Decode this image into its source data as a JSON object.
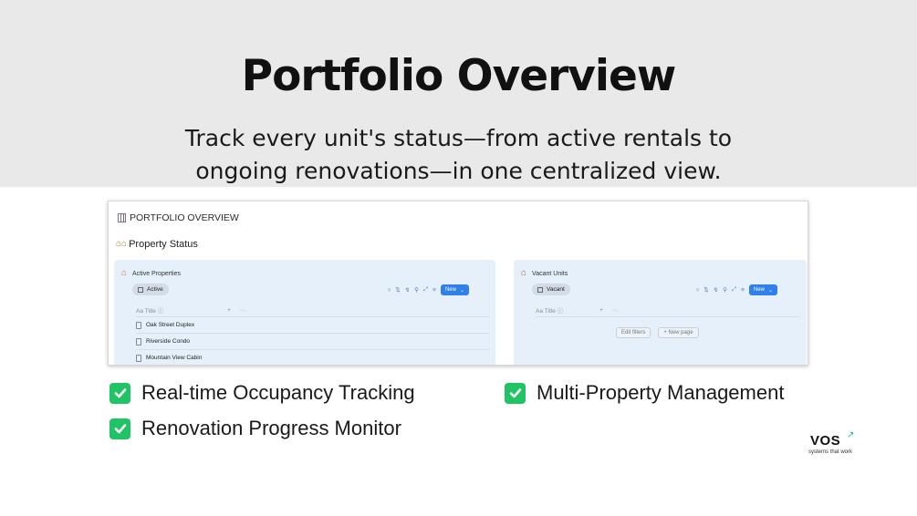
{
  "hero": {
    "title": "Portfolio Overview",
    "subtitle": "Track every unit's status—from active rentals to ongoing renovations—in one centralized view."
  },
  "screenshot": {
    "page_title": "PORTFOLIO OVERVIEW",
    "section_title": "Property Status",
    "left_panel": {
      "heading": "Active Properties",
      "view_label": "Active",
      "new_label": "New",
      "column_title": "Title",
      "rows": [
        "Oak Street Duplex",
        "Riverside Condo",
        "Mountain View Cabin"
      ]
    },
    "right_panel": {
      "heading": "Vacant Units",
      "view_label": "Vacant",
      "new_label": "New",
      "column_title": "Title",
      "edit_filters": "Edit filters",
      "new_page": "+ New page"
    }
  },
  "features": [
    "Real-time Occupancy Tracking",
    "Multi-Property Management",
    "Renovation Progress Monitor"
  ],
  "logo": {
    "word": "VOS",
    "tagline": "systems that work"
  },
  "colors": {
    "hero_bg": "#e9e9e9",
    "panel_bg": "#e6f0fb",
    "accent_blue": "#2f80ed",
    "check_green": "#21c465",
    "logo_teal": "#1fb89a"
  }
}
